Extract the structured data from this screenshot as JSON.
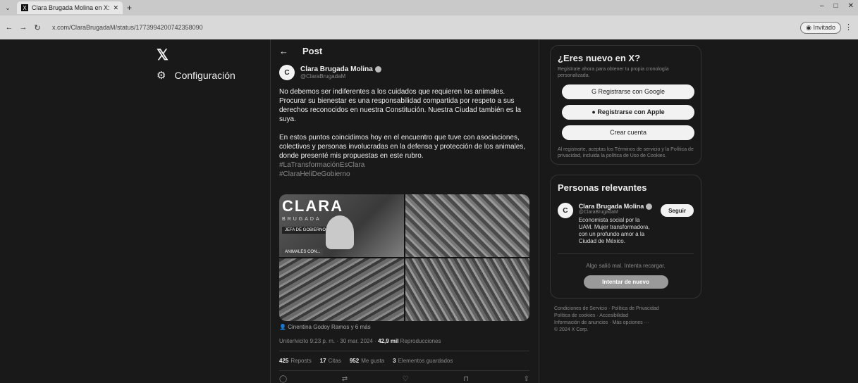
{
  "browser": {
    "tab_title": "Clara Brugada Molina en X: \"N...",
    "tab_favicon": "X",
    "url": "x.com/ClaraBrugadaM/status/1773994200742358090",
    "guest_label": "Invitado",
    "win_controls": [
      "–",
      "□",
      "✕"
    ]
  },
  "sidebar": {
    "logo": "𝕏",
    "settings_label": "Configuración"
  },
  "post": {
    "back_label": "←",
    "header_title": "Post",
    "author_name": "Clara Brugada Molina",
    "author_handle": "@ClaraBrugadaM",
    "avatar_initial": "C",
    "paragraph1": "No debemos ser indiferentes a los cuidados que requieren los animales. Procurar su bienestar es una responsabilidad compartida por respeto a sus derechos reconocidos en nuestra Constitución. Nuestra Ciudad también es la suya.",
    "paragraph2": "En estos puntos coincidimos hoy en el encuentro que tuve con asociaciones, colectivos y personas involucradas en la defensa y protección de los animales, donde presenté mis propuestas en este rubro.",
    "hashtag1": "#LaTransformaciónEsClara",
    "hashtag2": "#ClaraHeliDeGobierno",
    "banner_title": "CLARA",
    "banner_sub": "BRUGADA",
    "banner_pill": "JEFA DE GOBIERNO",
    "banner_animals": "ANIMALES CON...",
    "tagged": "Cinentina Godoy Ramos y 6 más",
    "meta_time": "Uniterlvicito 9:23 p. m. · 30 mar. 2024 ·",
    "views_count": "42,9 mil",
    "views_label": "Reproducciones",
    "stats": [
      {
        "count": "425",
        "label": "Reposts"
      },
      {
        "count": "17",
        "label": "Citas"
      },
      {
        "count": "952",
        "label": "Me gusta"
      },
      {
        "count": "3",
        "label": "Elementos guardados"
      }
    ],
    "actions": [
      "reply-icon",
      "repost-icon",
      "like-icon",
      "bookmark-icon",
      "share-icon"
    ]
  },
  "signup": {
    "title": "¿Eres nuevo en X?",
    "subtitle": "Regístrate ahora para obtener tu propia cronología personalizada.",
    "google_label": "Registrarse con Google",
    "apple_label": "Registrarse con Apple",
    "create_label": "Crear cuenta",
    "terms": "Al registrarte, aceptas los Términos de servicio y la Política de privacidad, incluida la política de Uso de Cookies."
  },
  "relevant": {
    "title": "Personas relevantes",
    "name": "Clara Brugada Molina",
    "handle": "@ClaraBrugadaM",
    "bio": "Economista social por la UAM. Mujer transformadora, con un profundo amor a la Ciudad de México.",
    "follow_label": "Seguir",
    "error_text": "Algo salió mal. Intenta recargar.",
    "retry_label": "Intentar de nuevo"
  },
  "footer": {
    "line1": "Condiciones de Servicio · Política de Privacidad",
    "line2": "Política de cookies · Accesibilidad",
    "line3": "Información de anuncios · Más opciones ···",
    "line4": "© 2024 X Corp."
  }
}
